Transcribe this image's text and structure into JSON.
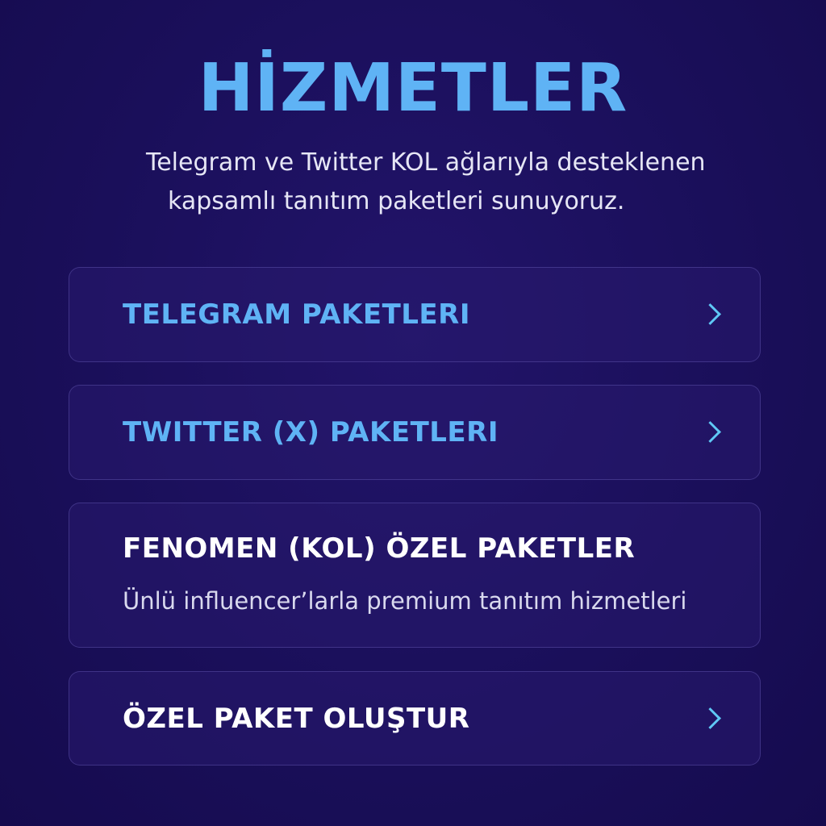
{
  "header": {
    "title": "HİZMETLER",
    "subtitle_line1": "Telegram ve Twitter KOL ağlarıyla desteklenen",
    "subtitle_line2": "kapsamlı tanıtım paketleri sunuyoruz."
  },
  "services": [
    {
      "label": "TELEGRAM PAKETLERI",
      "icon": "chevron-right-icon"
    },
    {
      "label": "TWITTER (X) PAKETLERI",
      "icon": "chevron-right-icon"
    },
    {
      "label": "FENOMEN (KOL) ÖZEL PAKETLER",
      "description": "Ünlü influencer’larla premium tanıtım hizmetleri"
    },
    {
      "label": "ÖZEL PAKET OLUŞTUR",
      "icon": "chevron-right-icon"
    }
  ],
  "colors": {
    "background": "#1a0f5a",
    "accent": "#5fb3f5",
    "chevron": "#5fc8f5",
    "card_bg": "#281a6e"
  }
}
